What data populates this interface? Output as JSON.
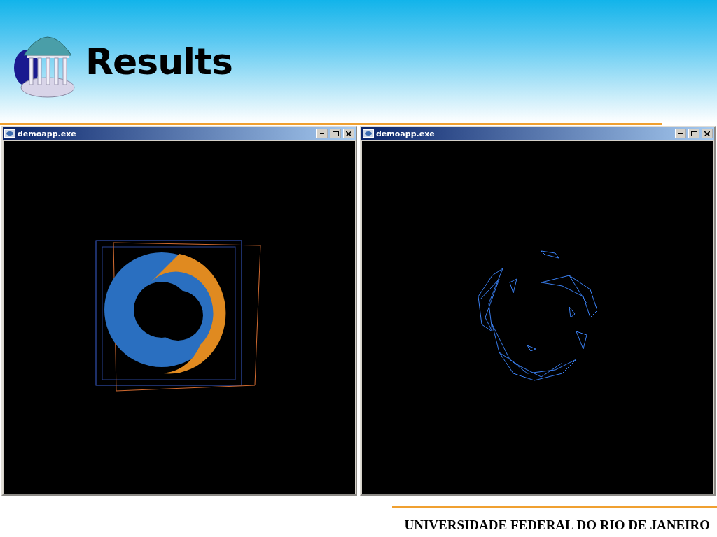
{
  "slide": {
    "title": "Results",
    "footer": "UNIVERSIDADE FEDERAL DO RIO DE JANEIRO"
  },
  "windows": [
    {
      "title": "demoapp.exe",
      "kind": "solid"
    },
    {
      "title": "demoapp.exe",
      "kind": "wireframe"
    }
  ]
}
